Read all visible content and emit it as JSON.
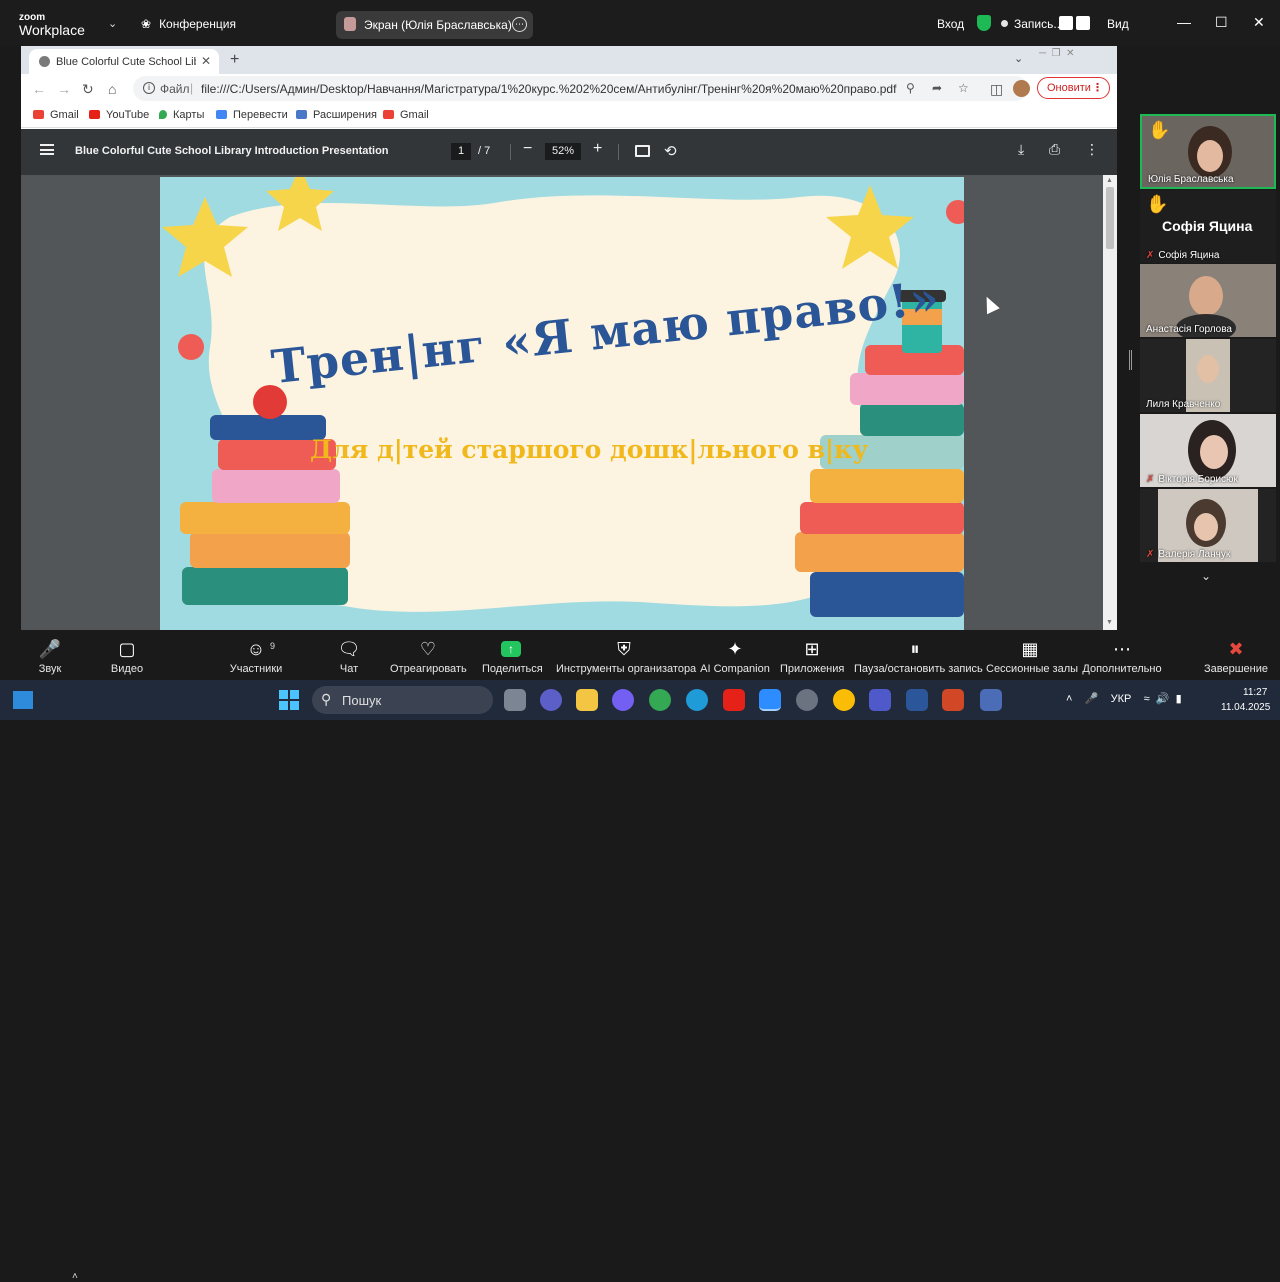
{
  "zoom_top": {
    "logo_top": "zoom",
    "logo_bottom": "Workplace",
    "conference": "Конференция",
    "screen_share": "Экран (Юлія Браславська)",
    "login": "Вход",
    "record_label": "Запись...",
    "view": "Вид"
  },
  "browser": {
    "tab_title": "Blue Colorful Cute School Library",
    "file_label": "Файл",
    "url": "file:///C:/Users/Админ/Desktop/Навчання/Магістратура/1%20курс.%202%20сем/Антибулінг/Тренінг%20я%20маю%20право.pdf",
    "update_label": "Оновити",
    "bookmarks": [
      "Gmail",
      "YouTube",
      "Карты",
      "Перевести",
      "Расширения",
      "Gmail"
    ]
  },
  "pdf": {
    "title": "Blue Colorful Cute School Library Introduction Presentation",
    "page_current": "1",
    "page_total": "/ 7",
    "zoom": "52%"
  },
  "slide": {
    "title": "Трен|нг «Я маю право!»",
    "subtitle": "Для д|тей старшого дошк|льного в|ку"
  },
  "participants": [
    {
      "name": "Юлія Браславська",
      "hand": true,
      "muted": false,
      "video": true
    },
    {
      "name": "Софія Яцина",
      "hand": true,
      "muted": true,
      "video": false,
      "big_name": "Софія Яцина"
    },
    {
      "name": "Анастасія Горлова",
      "hand": false,
      "muted": false,
      "video": true
    },
    {
      "name": "Лиля Кравченко",
      "hand": false,
      "muted": false,
      "video": true
    },
    {
      "name": "Вікторія Борисюк",
      "hand": false,
      "muted": true,
      "video": true
    },
    {
      "name": "Валерія Ланчук",
      "hand": false,
      "muted": true,
      "video": true
    }
  ],
  "zoom_bottom": {
    "sound": "Звук",
    "video": "Видео",
    "participants": "Участники",
    "participants_count": "9",
    "chat": "Чат",
    "react": "Отреагировать",
    "share": "Поделиться",
    "host_tools": "Инструменты организатора",
    "ai": "AI Companion",
    "apps": "Приложения",
    "pause_record": "Пауза/остановить запись",
    "breakout": "Сессионные залы",
    "more": "Дополнительно",
    "end": "Завершение"
  },
  "taskbar": {
    "search": "Пошук",
    "lang": "УКР",
    "time": "11:27",
    "date": "11.04.2025"
  },
  "colors": {
    "pdf_toolbar": "#323639",
    "slide_bg": "#9fdbe0",
    "slide_title": "#2a5596",
    "slide_subtitle": "#f0b81a",
    "speaker_border": "#1db954"
  }
}
